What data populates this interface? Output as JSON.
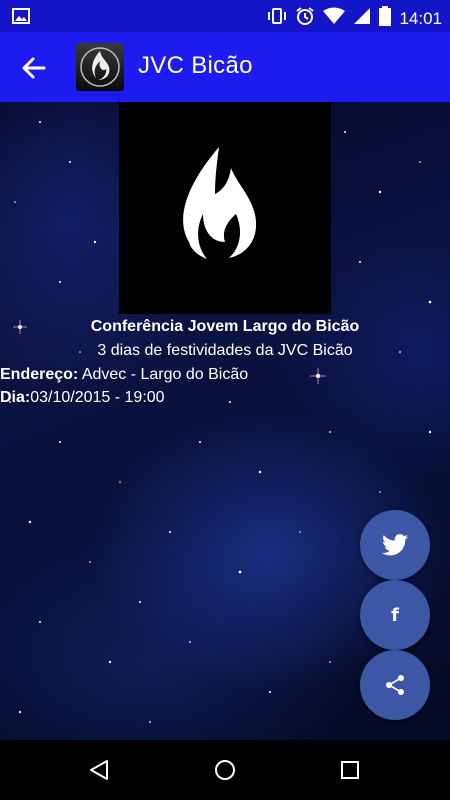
{
  "status_bar": {
    "time": "14:01",
    "icons": [
      "image-icon",
      "vibrate-icon",
      "alarm-icon",
      "wifi-icon",
      "signal-icon",
      "battery-icon"
    ]
  },
  "app_bar": {
    "title": "JVC Bicão",
    "back_icon": "arrow-back-icon",
    "logo_icon": "flame-logo-icon"
  },
  "event": {
    "title": "Conferência Jovem Largo do Bicão",
    "subtitle": "3 dias de festividades da JVC Bicão",
    "address_label": "Endereço:",
    "address_value": " Advec - Largo do Bicão",
    "date_label": "Dia:",
    "date_value": "03/10/2015 - 19:00"
  },
  "fabs": {
    "twitter_icon": "twitter-icon",
    "facebook_label": "f",
    "share_icon": "share-icon",
    "color": "#3b57a6"
  },
  "nav_bar": {
    "icons": [
      "back-triangle-icon",
      "home-circle-icon",
      "recent-square-icon"
    ]
  },
  "colors": {
    "status_bar": "#1414c8",
    "app_bar": "#1c1cf0"
  }
}
